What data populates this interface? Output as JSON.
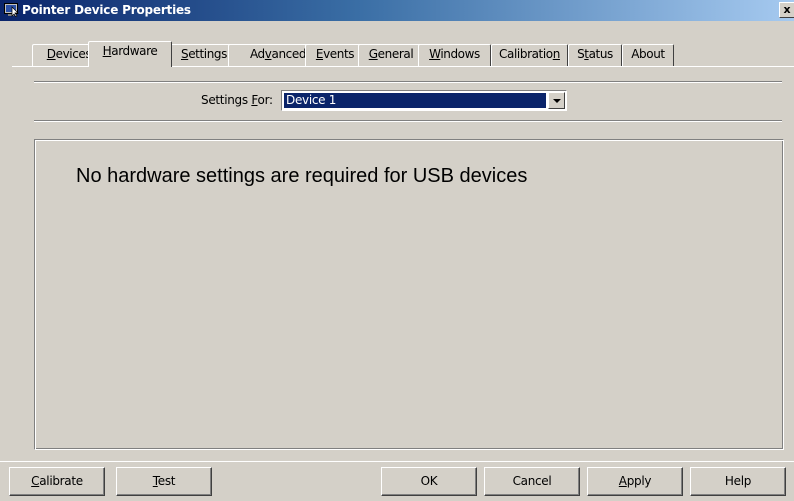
{
  "window": {
    "title": "Pointer Device Properties",
    "close_label": "x",
    "icon": "pointer-device-app-icon"
  },
  "tabs": [
    {
      "label_pre": "",
      "label_u": "D",
      "label_post": "evices",
      "active": false
    },
    {
      "label_pre": "",
      "label_u": "H",
      "label_post": "ardware",
      "active": true
    },
    {
      "label_pre": "",
      "label_u": "S",
      "label_post": "ettings",
      "active": false
    },
    {
      "label_pre": "Ad",
      "label_u": "v",
      "label_post": "anced",
      "active": false
    },
    {
      "label_pre": "",
      "label_u": "E",
      "label_post": "vents",
      "active": false
    },
    {
      "label_pre": "",
      "label_u": "G",
      "label_post": "eneral",
      "active": false
    },
    {
      "label_pre": "",
      "label_u": "W",
      "label_post": "indows",
      "active": false
    },
    {
      "label_pre": "Calibratio",
      "label_u": "n",
      "label_post": "",
      "active": false
    },
    {
      "label_pre": "S",
      "label_u": "t",
      "label_post": "atus",
      "active": false
    },
    {
      "label_pre": "About",
      "label_u": "",
      "label_post": "",
      "active": false
    }
  ],
  "settings_for": {
    "label_pre": "Settings ",
    "label_u": "F",
    "label_post": "or:",
    "selected_value": "Device 1"
  },
  "message": "No hardware settings are required for USB devices",
  "buttons": {
    "calibrate": {
      "pre": "",
      "u": "C",
      "post": "alibrate"
    },
    "test": {
      "pre": "",
      "u": "T",
      "post": "est"
    },
    "ok": {
      "pre": "OK",
      "u": "",
      "post": ""
    },
    "cancel": {
      "pre": "Cancel",
      "u": "",
      "post": ""
    },
    "apply": {
      "pre": "",
      "u": "A",
      "post": "pply"
    },
    "help": {
      "pre": "Help",
      "u": "",
      "post": ""
    }
  },
  "colors": {
    "face": "#d4d0c8",
    "title_active": "#0a246a",
    "selection": "#0a246a"
  }
}
